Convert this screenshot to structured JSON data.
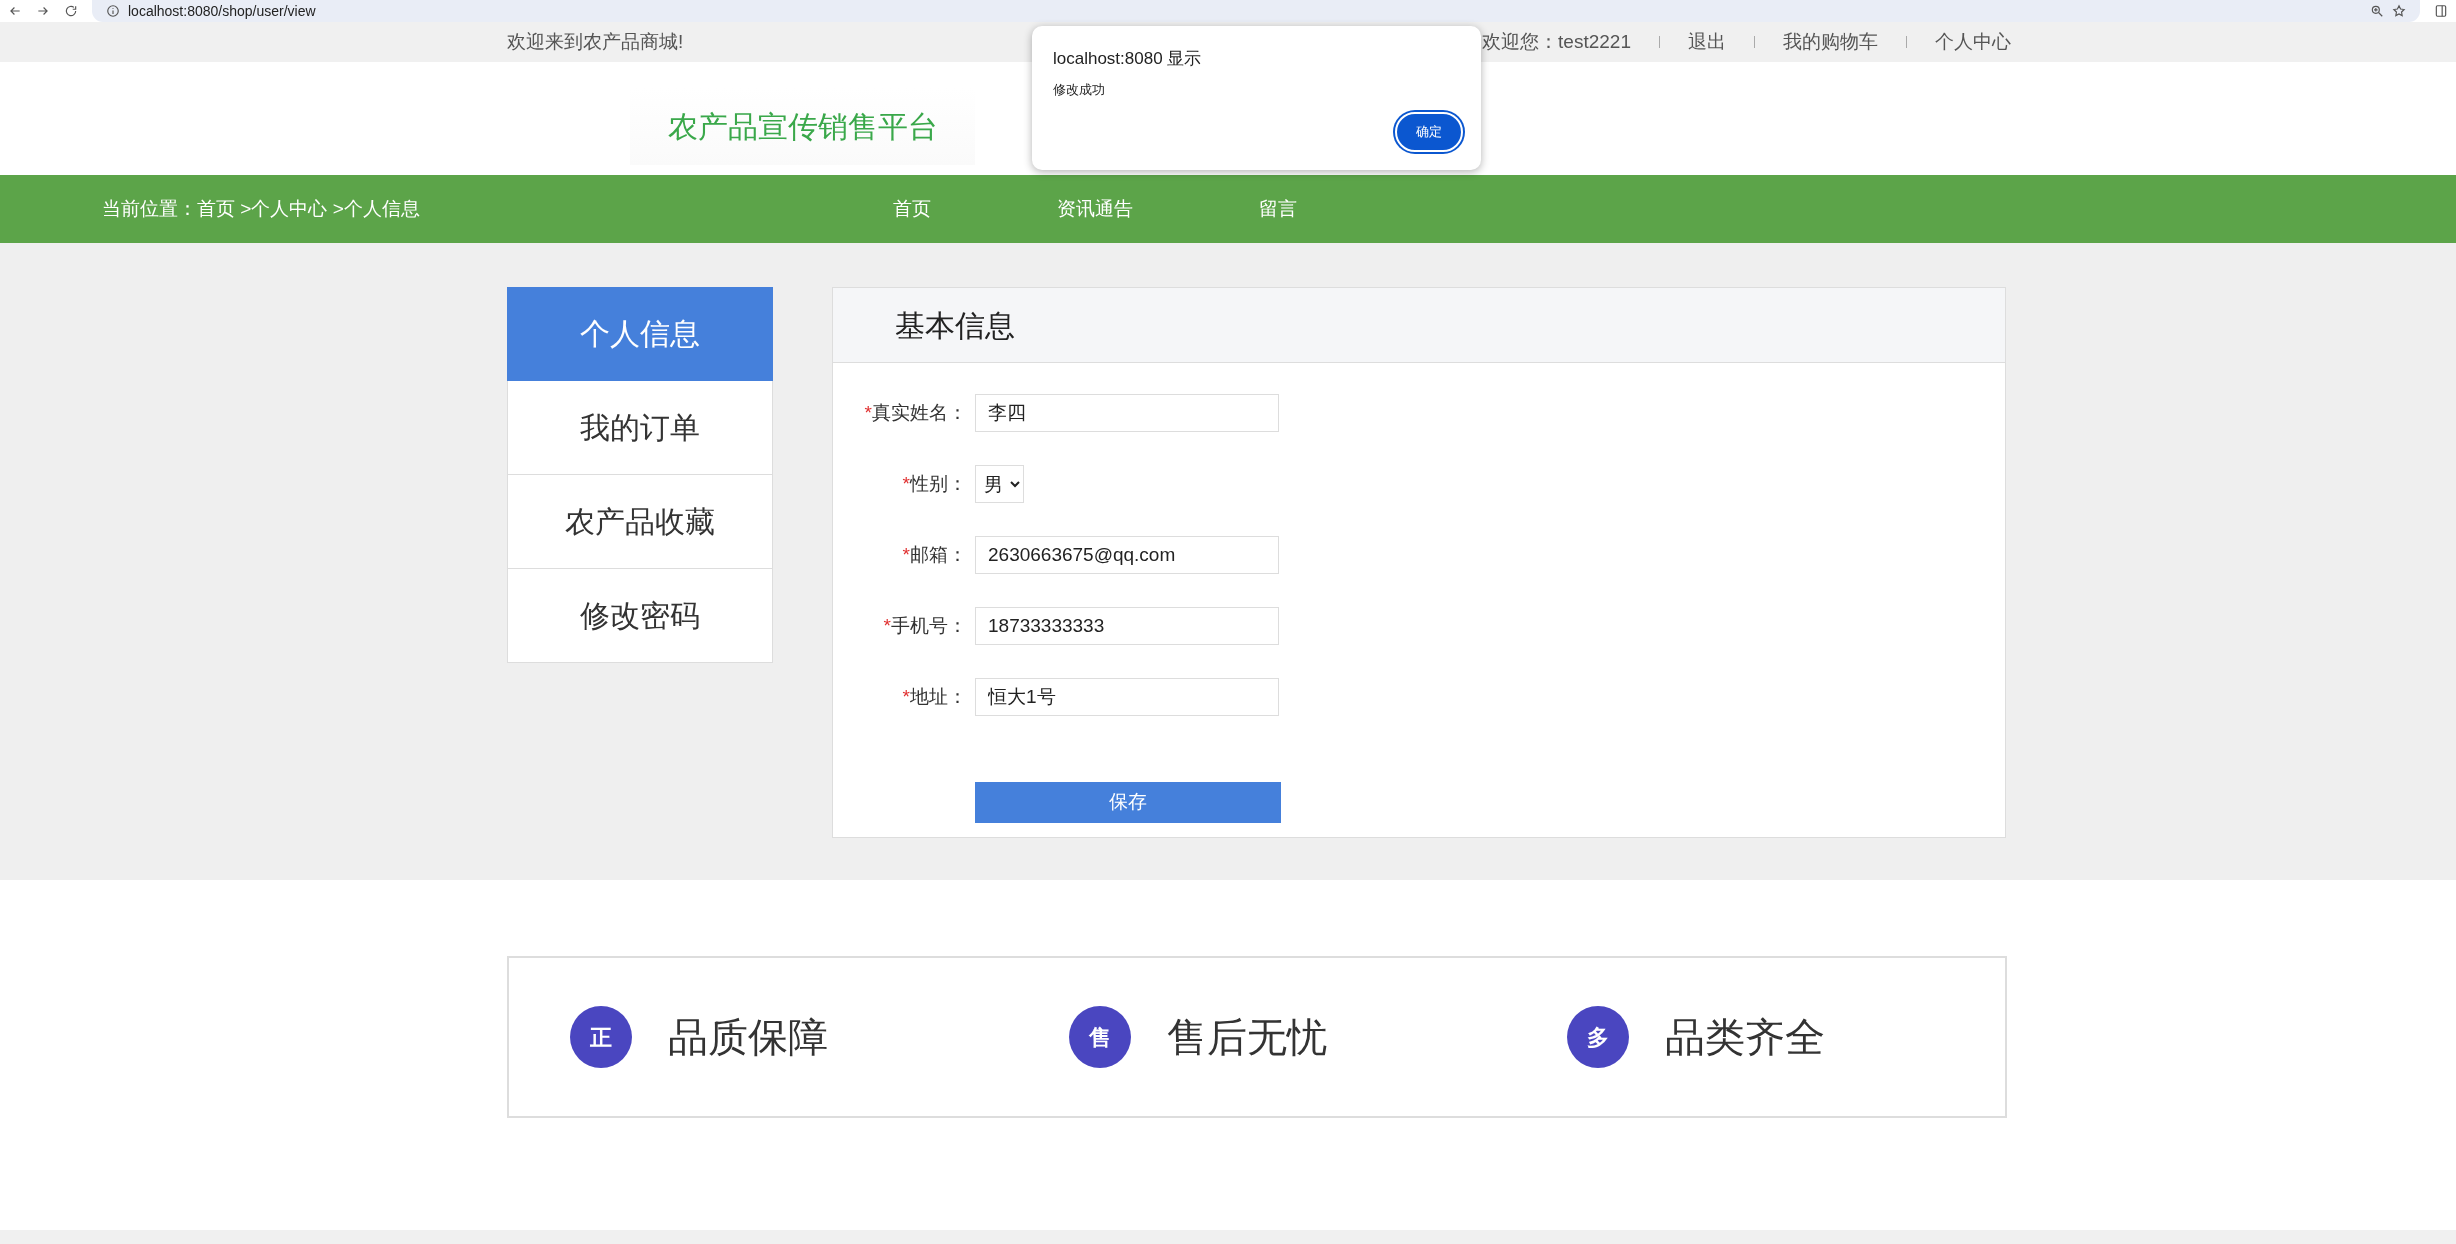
{
  "browser": {
    "url": "localhost:8080/shop/user/view"
  },
  "top_bar": {
    "welcome": "欢迎来到农产品商城!",
    "links": [
      "欢迎您：test2221",
      "退出",
      "我的购物车",
      "个人中心"
    ]
  },
  "logo": "农产品宣传销售平台",
  "nav": {
    "breadcrumb": "当前位置：首页 >个人中心 >个人信息",
    "items": [
      "首页",
      "资讯通告",
      "留言"
    ]
  },
  "sidebar": [
    {
      "label": "个人信息",
      "selected": true
    },
    {
      "label": "我的订单",
      "selected": false
    },
    {
      "label": "农产品收藏",
      "selected": false
    },
    {
      "label": "修改密码",
      "selected": false
    }
  ],
  "panel": {
    "title": "基本信息",
    "fields": [
      {
        "kind": "text",
        "mark": "*",
        "label": "真实姓名：",
        "value": "李四"
      },
      {
        "kind": "select",
        "mark": "*",
        "label": "性别：",
        "value": "男"
      },
      {
        "kind": "text",
        "mark": "*",
        "label": "邮箱：",
        "value": "2630663675@qq.com"
      },
      {
        "kind": "text",
        "mark": "*",
        "label": "手机号：",
        "value": "18733333333"
      },
      {
        "kind": "text",
        "mark": "*",
        "label": "地址：",
        "value": "恒大1号"
      }
    ],
    "save_button": "保存"
  },
  "features": [
    {
      "badge": "正",
      "label": "品质保障"
    },
    {
      "badge": "售",
      "label": "售后无忧"
    },
    {
      "badge": "多",
      "label": "品类齐全"
    }
  ],
  "dialog": {
    "title": "localhost:8080 显示",
    "message": "修改成功",
    "button": "确定"
  }
}
